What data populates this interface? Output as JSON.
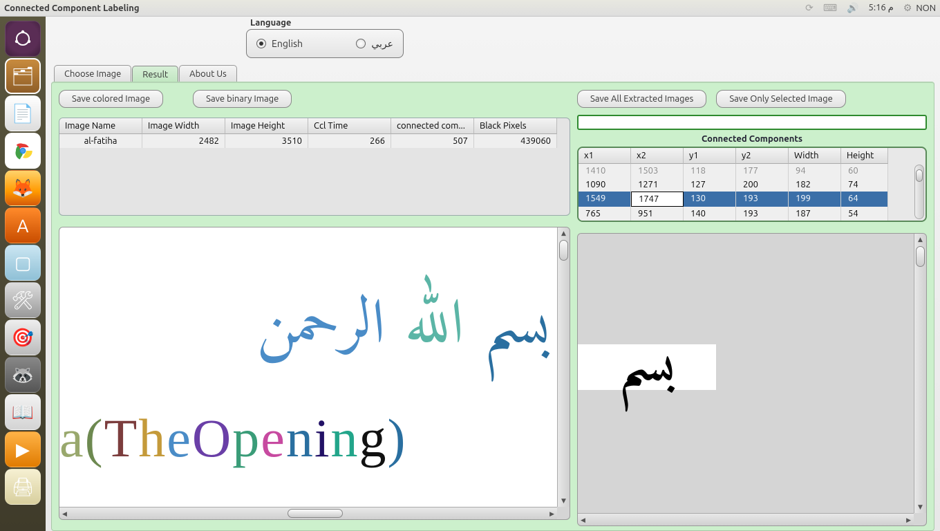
{
  "menubar": {
    "title": "Connected Component Labeling",
    "clock": "5:16 م",
    "user": "NON"
  },
  "language": {
    "label": "Language",
    "options": [
      {
        "label": "English",
        "checked": true
      },
      {
        "label": "عربي",
        "checked": false
      }
    ]
  },
  "tabs": {
    "choose": "Choose Image",
    "result": "Result",
    "about": "About Us",
    "active": "Result"
  },
  "buttons": {
    "save_colored": "Save colored Image",
    "save_binary": "Save binary Image",
    "save_all": "Save All Extracted Images",
    "save_selected": "Save Only Selected Image"
  },
  "info_table": {
    "headers": [
      "Image Name",
      "Image Width",
      "Image Height",
      "Ccl Time",
      "connected com...",
      "Black Pixels"
    ],
    "row": [
      "al-fatiha",
      "2482",
      "3510",
      "266",
      "507",
      "439060"
    ]
  },
  "cc_panel": {
    "title": "Connected Components",
    "headers": [
      "x1",
      "x2",
      "y1",
      "y2",
      "Width",
      "Height"
    ],
    "rows": [
      {
        "cells": [
          "1410",
          "1503",
          "118",
          "177",
          "94",
          "60"
        ],
        "faded": true
      },
      {
        "cells": [
          "1090",
          "1271",
          "127",
          "200",
          "182",
          "74"
        ],
        "faded": false
      },
      {
        "cells": [
          "1549",
          "1747",
          "130",
          "193",
          "199",
          "64"
        ],
        "selected": true
      },
      {
        "cells": [
          "765",
          "951",
          "140",
          "193",
          "187",
          "54"
        ],
        "faded": false
      }
    ]
  },
  "viewer_left": {
    "arabic_words": [
      {
        "text": "بسم",
        "color": "#2a6fa0"
      },
      {
        "text": "الله",
        "color": "#5bb5a6"
      },
      {
        "text": "الرحمن",
        "color": "#4a8cc7"
      }
    ],
    "latin_chars": [
      {
        "t": "a",
        "c": "#99a86d"
      },
      {
        "t": " (",
        "c": "#6d8950"
      },
      {
        "t": "T",
        "c": "#7c3d3d"
      },
      {
        "t": "h",
        "c": "#c49a3a"
      },
      {
        "t": "e",
        "c": "#4a8cc7"
      },
      {
        "t": " O",
        "c": "#6a3fa7"
      },
      {
        "t": "p",
        "c": "#3a9c78"
      },
      {
        "t": "e",
        "c": "#c74aa0"
      },
      {
        "t": "n",
        "c": "#2a6fa0"
      },
      {
        "t": "i",
        "c": "#221166"
      },
      {
        "t": "n",
        "c": "#22a58a"
      },
      {
        "t": "g",
        "c": "#111"
      },
      {
        "t": ")",
        "c": "#2a6fa0"
      }
    ]
  },
  "viewer_right": {
    "glyph": "بسم"
  }
}
